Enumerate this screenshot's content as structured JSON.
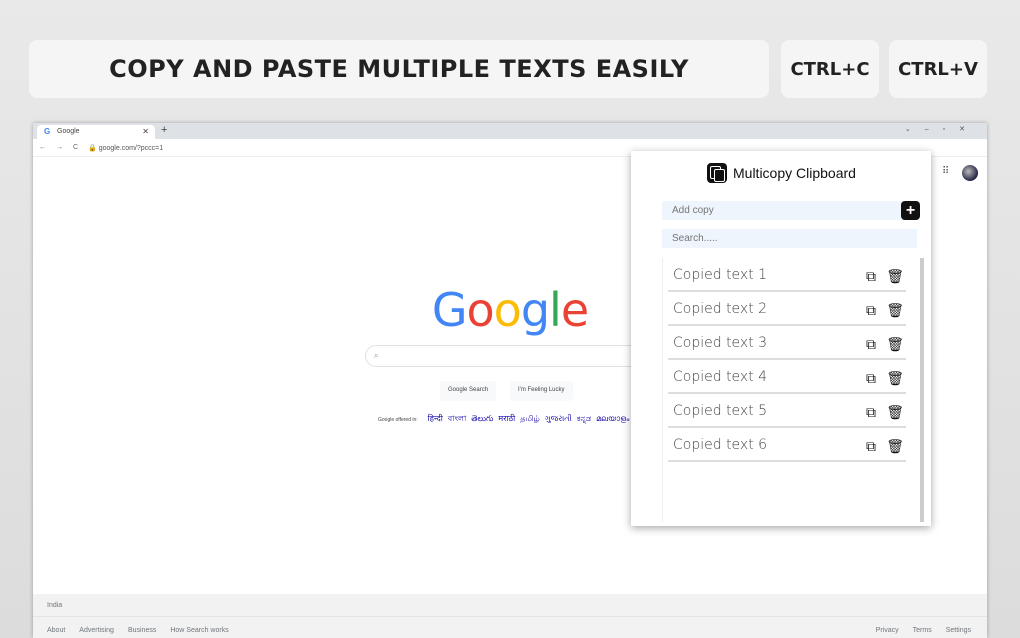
{
  "banner": {
    "title": "COPY AND PASTE MULTIPLE TEXTS EASILY",
    "key1": "CTRL+C",
    "key2": "CTRL+V"
  },
  "browser": {
    "tab_title": "Google",
    "url": "google.com/?pccc=1"
  },
  "google": {
    "logo": [
      "G",
      "o",
      "o",
      "g",
      "l",
      "e"
    ],
    "logo_colors": [
      "#4285f4",
      "#ea4335",
      "#fbbc05",
      "#4285f4",
      "#34a853",
      "#ea4335"
    ],
    "search_button": "Google Search",
    "lucky_button": "I'm Feeling Lucky",
    "offered_in": "Google offered in:",
    "languages": [
      "हिन्दी",
      "বাংলা",
      "తెలుగు",
      "मराठी",
      "தமிழ்",
      "ગુજરાતી",
      "ಕನ್ನಡ",
      "മലയാളം"
    ],
    "country": "India",
    "footer_left": [
      "About",
      "Advertising",
      "Business",
      "How Search works"
    ],
    "footer_right": [
      "Privacy",
      "Terms",
      "Settings"
    ]
  },
  "popup": {
    "title": "Multicopy Clipboard",
    "add_placeholder": "Add copy",
    "search_placeholder": "Search.....",
    "items": [
      "Copied text 1",
      "Copied text 2",
      "Copied text 3",
      "Copied text 4",
      "Copied text 5",
      "Copied text 6"
    ]
  }
}
